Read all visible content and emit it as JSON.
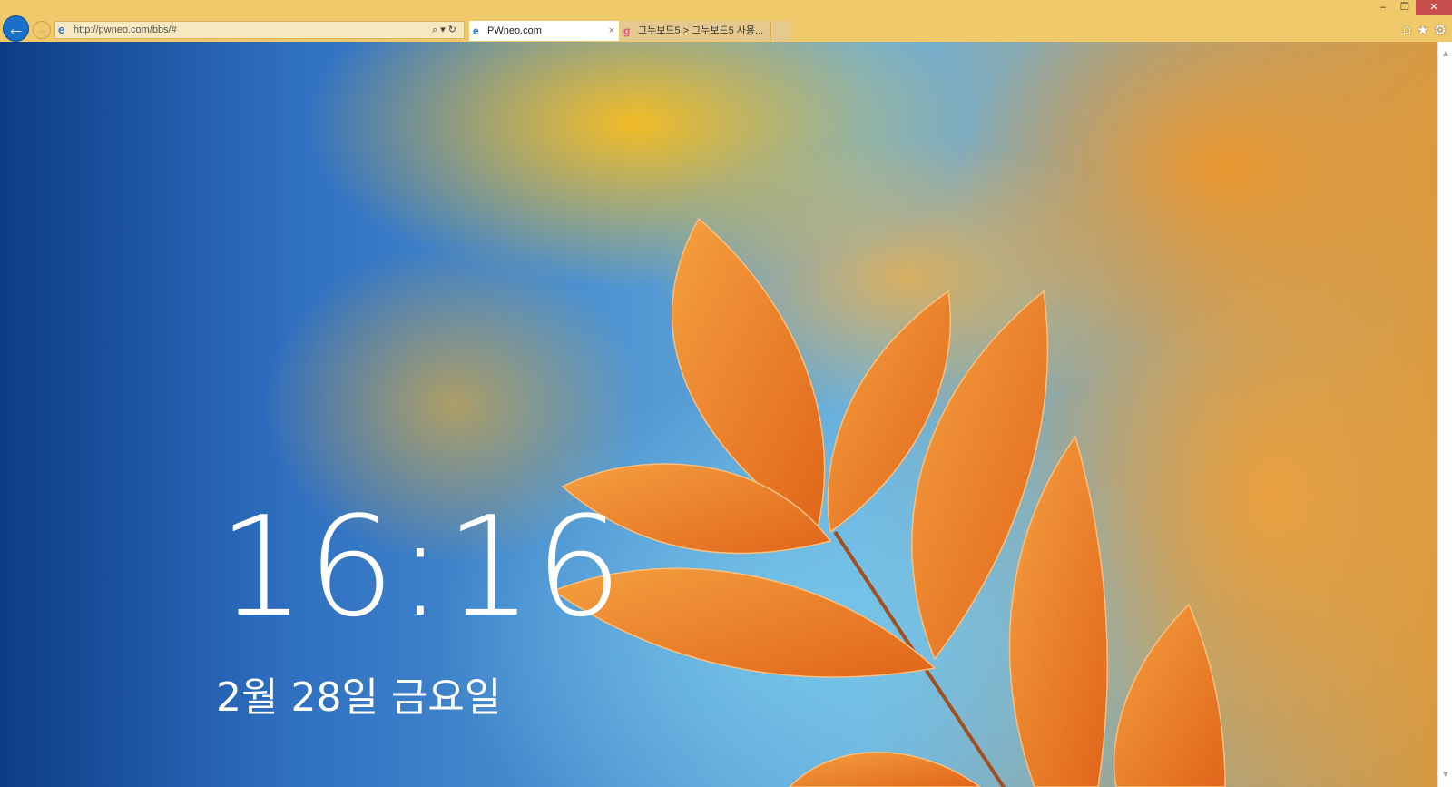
{
  "browser": {
    "address": "http://pwneo.com/bbs/#",
    "tabs": [
      {
        "title": "PWneo.com",
        "active": true
      },
      {
        "title": "그누보드5 > 그누보드5 사용...",
        "active": false
      }
    ],
    "close_tab": "×",
    "back": "←",
    "forward": "→",
    "search_tools": "⌕▾↻",
    "window": {
      "minimize": "–",
      "restore": "❐",
      "close": "✕"
    },
    "toolbar": {
      "home": "⌂",
      "favorites": "★",
      "settings": "⚙"
    }
  },
  "lockscreen": {
    "time": "16:16",
    "date": "2월 28일 금요일"
  },
  "scrollbar": {
    "up": "▲",
    "down": "▼"
  }
}
